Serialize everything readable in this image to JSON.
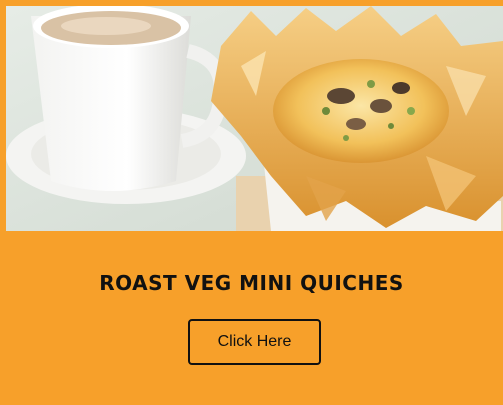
{
  "theme": {
    "accent": "#F7A02A",
    "text": "#111111"
  },
  "hero": {
    "image": "photo of a mug of coffee and a filo pastry mini quiche with roasted vegetables"
  },
  "card": {
    "title": "ROAST VEG MINI QUICHES",
    "button_label": "Click Here"
  }
}
